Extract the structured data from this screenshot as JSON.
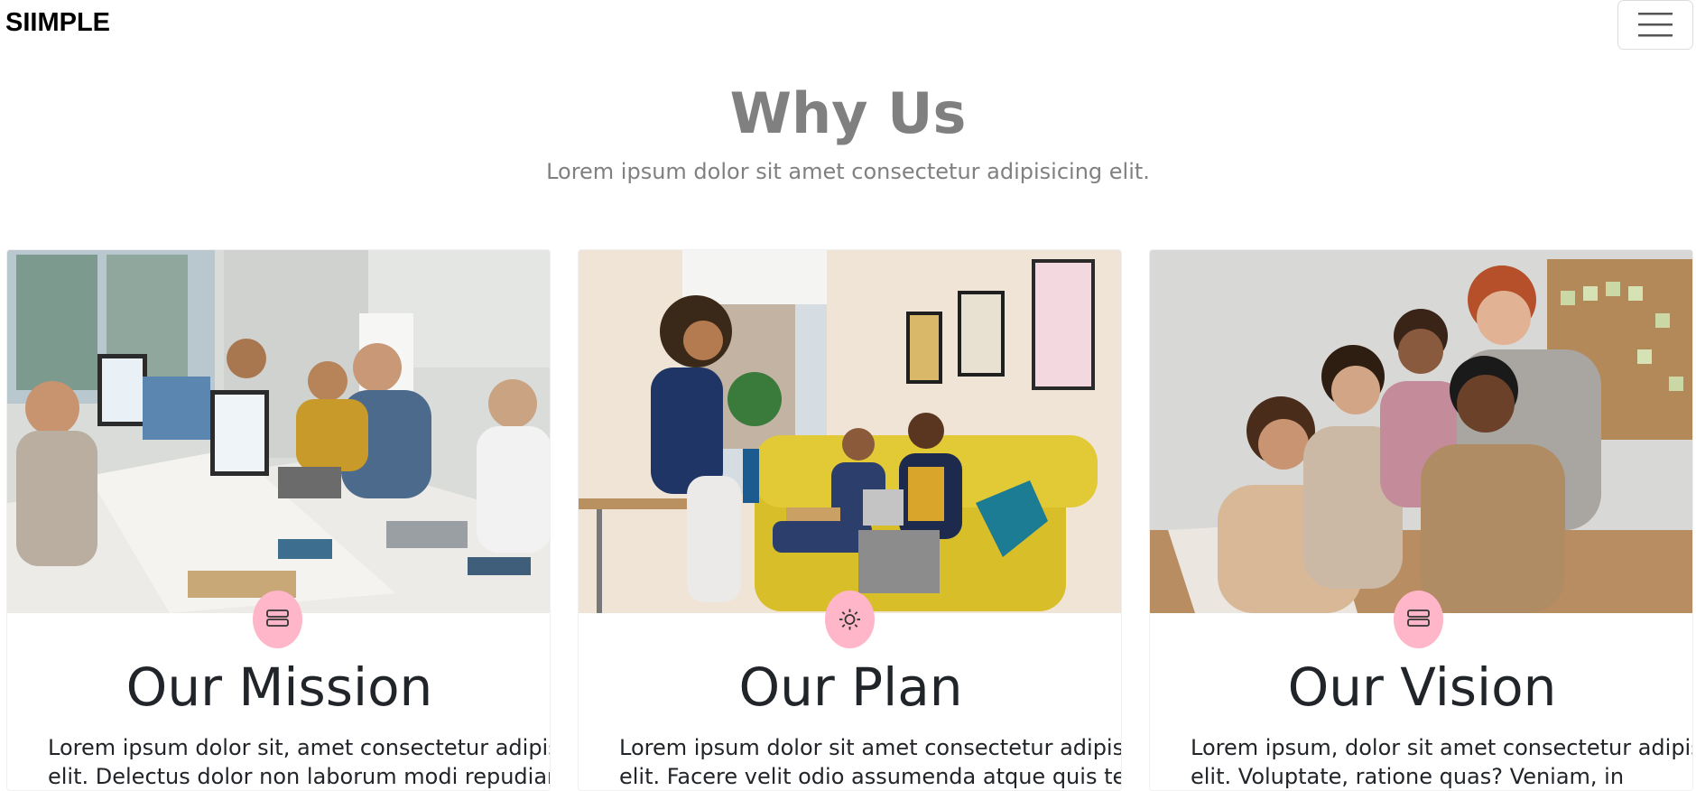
{
  "navbar": {
    "brand": "SIIMPLE",
    "toggle_icon": "hamburger-menu-icon"
  },
  "section": {
    "title": "Why Us",
    "subtitle": "Lorem ipsum dolor sit amet consectetur adipisicing elit."
  },
  "cards": [
    {
      "title": "Our Mission",
      "icon": "server-stack-icon",
      "text_line1": "Lorem ipsum dolor sit, amet consectetur adipisicing",
      "text_line2": "elit. Delectus dolor non laborum modi repudiandae"
    },
    {
      "title": "Our Plan",
      "icon": "sun-icon",
      "text_line1": "Lorem ipsum dolor sit amet consectetur adipisicing",
      "text_line2": "elit. Facere velit odio assumenda atque quis tenetur"
    },
    {
      "title": "Our Vision",
      "icon": "server-stack-icon",
      "text_line1": "Lorem ipsum, dolor sit amet consectetur adipisicing",
      "text_line2": "elit. Voluptate, ratione quas? Veniam, in"
    }
  ],
  "colors": {
    "heading_gray": "#808080",
    "icon_badge_pink": "#ffb6c8",
    "text_dark": "#212529"
  }
}
